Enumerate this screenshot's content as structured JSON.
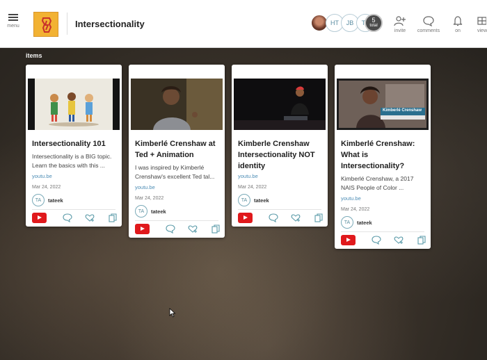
{
  "header": {
    "menu_label": "menu",
    "title": "Intersectionality",
    "avatars": [
      "HT",
      "JB",
      "TA"
    ],
    "total_count": "5",
    "total_label": "total",
    "tools": [
      {
        "icon": "invite-icon",
        "label": "invite"
      },
      {
        "icon": "comments-icon",
        "label": "comments"
      },
      {
        "icon": "bell-icon",
        "label": "on"
      },
      {
        "icon": "view-icon",
        "label": "view"
      }
    ]
  },
  "items_label": "items",
  "cards": [
    {
      "title": "Intersectionality 101",
      "description": "Intersectionality is a BIG topic. Learn the basics with this ...",
      "domain": "youtu.be",
      "date": "Mar 24, 2022",
      "author_initials": "TA",
      "author_name": "tateek"
    },
    {
      "title": "Kimberlé Crenshaw at Ted + Animation",
      "description": "I was inspired by Kimberlé Crenshaw's excellent Ted tal...",
      "domain": "youtu.be",
      "date": "Mar 24, 2022",
      "author_initials": "TA",
      "author_name": "tateek"
    },
    {
      "title": "Kimberle Crenshaw Intersectionality NOT identity",
      "description": "",
      "domain": "youtu.be",
      "date": "Mar 24, 2022",
      "author_initials": "TA",
      "author_name": "tateek"
    },
    {
      "title": "Kimberlé Crenshaw: What is Intersectionality?",
      "description": "Kimberlé Crenshaw, a 2017 NAIS People of Color ...",
      "domain": "youtu.be",
      "date": "Mar 24, 2022",
      "author_initials": "TA",
      "author_name": "tateek",
      "thumb_caption": "Kimberlé Crenshaw"
    }
  ],
  "colors": {
    "accent": "#4d8db5",
    "youtube": "#e0191c",
    "logo": "#f2b233"
  }
}
